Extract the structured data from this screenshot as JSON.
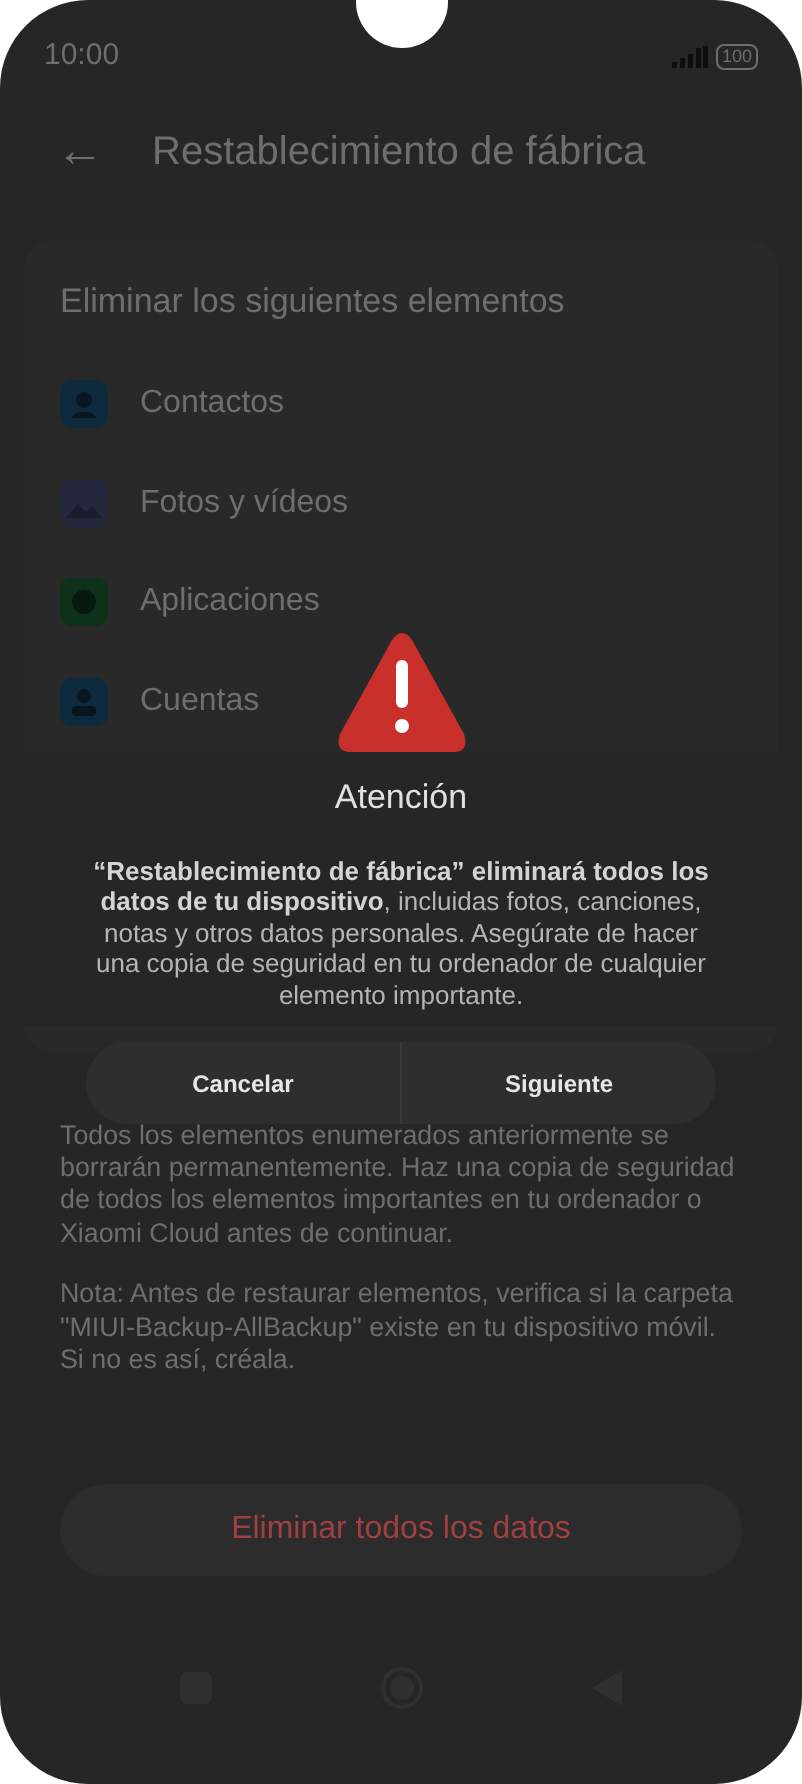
{
  "status_bar": {
    "time": "10:00",
    "battery": "100"
  },
  "header": {
    "back": "←",
    "title": "Restablecimiento de fábrica"
  },
  "section": {
    "title": "Eliminar los siguientes elementos",
    "items": [
      {
        "label": "Contactos",
        "kind": "contact",
        "color": "#0d2b3d"
      },
      {
        "label": "Fotos y vídeos",
        "kind": "photo",
        "color": "#25283c"
      },
      {
        "label": "Aplicaciones",
        "kind": "apps",
        "color": "#0d3119"
      },
      {
        "label": "Cuentas",
        "kind": "account",
        "color": "#0d2a3f"
      }
    ]
  },
  "info": "Todos los elementos enumerados anteriormente se borrarán permanentemente. Haz una copia de seguridad de todos los elementos importantes en tu ordenador o Xiaomi Cloud antes de continuar.",
  "note": "Nota: Antes de restaurar elementos, verifica si la carpeta \"MIUI-Backup-AllBackup\" existe en tu dispositivo móvil. Si no es así, créala.",
  "main_button": "Eliminar todos los datos",
  "dialog": {
    "title": "Atención",
    "message": "**“Restablecimiento de fábrica” eliminará todos los datos de tu dispositivo**, incluidas fotos, canciones, notas y otros datos personales. Asegúrate de hacer una copia de seguridad en tu ordenador de cualquier elemento importante.",
    "buttons": [
      "Cancelar",
      "Siguiente"
    ]
  }
}
